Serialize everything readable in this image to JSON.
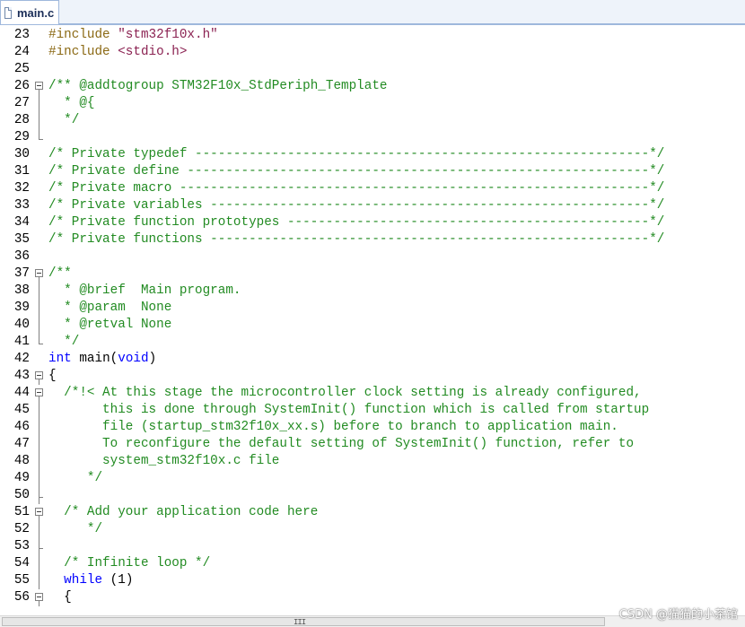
{
  "tab": {
    "label": "main.c",
    "icon": "file-icon"
  },
  "colors": {
    "comment": "#228b22",
    "preprocessor": "#8b6914",
    "string": "#8b2252",
    "keyword": "#0000ff",
    "text": "#000000"
  },
  "lines": [
    {
      "n": "23",
      "fold": "",
      "tokens": [
        {
          "t": "#include ",
          "c": "pp"
        },
        {
          "t": "\"stm32f10x.h\"",
          "c": "str"
        }
      ]
    },
    {
      "n": "24",
      "fold": "",
      "tokens": [
        {
          "t": "#include ",
          "c": "pp"
        },
        {
          "t": "<stdio.h>",
          "c": "str"
        }
      ]
    },
    {
      "n": "25",
      "fold": "",
      "tokens": []
    },
    {
      "n": "26",
      "fold": "box",
      "tokens": [
        {
          "t": "/** @addtogroup STM32F10x_StdPeriph_Template",
          "c": "comment"
        }
      ]
    },
    {
      "n": "27",
      "fold": "line",
      "tokens": [
        {
          "t": "  * @{",
          "c": "comment"
        }
      ]
    },
    {
      "n": "28",
      "fold": "line",
      "tokens": [
        {
          "t": "  */",
          "c": "comment"
        }
      ]
    },
    {
      "n": "29",
      "fold": "end",
      "tokens": []
    },
    {
      "n": "30",
      "fold": "",
      "tokens": [
        {
          "t": "/* Private typedef -----------------------------------------------------------*/",
          "c": "comment"
        }
      ]
    },
    {
      "n": "31",
      "fold": "",
      "tokens": [
        {
          "t": "/* Private define ------------------------------------------------------------*/",
          "c": "comment"
        }
      ]
    },
    {
      "n": "32",
      "fold": "",
      "tokens": [
        {
          "t": "/* Private macro -------------------------------------------------------------*/",
          "c": "comment"
        }
      ]
    },
    {
      "n": "33",
      "fold": "",
      "tokens": [
        {
          "t": "/* Private variables ---------------------------------------------------------*/",
          "c": "comment"
        }
      ]
    },
    {
      "n": "34",
      "fold": "",
      "tokens": [
        {
          "t": "/* Private function prototypes -----------------------------------------------*/",
          "c": "comment"
        }
      ]
    },
    {
      "n": "35",
      "fold": "",
      "tokens": [
        {
          "t": "/* Private functions ---------------------------------------------------------*/",
          "c": "comment"
        }
      ]
    },
    {
      "n": "36",
      "fold": "",
      "tokens": []
    },
    {
      "n": "37",
      "fold": "box",
      "tokens": [
        {
          "t": "/**",
          "c": "comment"
        }
      ]
    },
    {
      "n": "38",
      "fold": "line",
      "tokens": [
        {
          "t": "  * @brief  Main program.",
          "c": "comment"
        }
      ]
    },
    {
      "n": "39",
      "fold": "line",
      "tokens": [
        {
          "t": "  * @param  None",
          "c": "comment"
        }
      ]
    },
    {
      "n": "40",
      "fold": "line",
      "tokens": [
        {
          "t": "  * @retval None",
          "c": "comment"
        }
      ]
    },
    {
      "n": "41",
      "fold": "end",
      "tokens": [
        {
          "t": "  */",
          "c": "comment"
        }
      ]
    },
    {
      "n": "42",
      "fold": "",
      "tokens": [
        {
          "t": "int",
          "c": "kw"
        },
        {
          "t": " main(",
          "c": "plain"
        },
        {
          "t": "void",
          "c": "kw"
        },
        {
          "t": ")",
          "c": "plain"
        }
      ]
    },
    {
      "n": "43",
      "fold": "box",
      "tokens": [
        {
          "t": "{",
          "c": "plain"
        }
      ]
    },
    {
      "n": "44",
      "fold": "box",
      "tokens": [
        {
          "t": "  /*!< At this stage the microcontroller clock setting is already configured,",
          "c": "comment"
        }
      ]
    },
    {
      "n": "45",
      "fold": "line",
      "tokens": [
        {
          "t": "       this is done through SystemInit() function which is called from startup",
          "c": "comment"
        }
      ]
    },
    {
      "n": "46",
      "fold": "line",
      "tokens": [
        {
          "t": "       file (startup_stm32f10x_xx.s) before to branch to application main.",
          "c": "comment"
        }
      ]
    },
    {
      "n": "47",
      "fold": "line",
      "tokens": [
        {
          "t": "       To reconfigure the default setting of SystemInit() function, refer to",
          "c": "comment"
        }
      ]
    },
    {
      "n": "48",
      "fold": "line",
      "tokens": [
        {
          "t": "       system_stm32f10x.c file",
          "c": "comment"
        }
      ]
    },
    {
      "n": "49",
      "fold": "line",
      "tokens": [
        {
          "t": "     */",
          "c": "comment"
        }
      ]
    },
    {
      "n": "50",
      "fold": "mid",
      "tokens": []
    },
    {
      "n": "51",
      "fold": "box",
      "tokens": [
        {
          "t": "  /* Add your application code here",
          "c": "comment"
        }
      ]
    },
    {
      "n": "52",
      "fold": "line",
      "tokens": [
        {
          "t": "     */",
          "c": "comment"
        }
      ]
    },
    {
      "n": "53",
      "fold": "mid",
      "tokens": []
    },
    {
      "n": "54",
      "fold": "line",
      "tokens": [
        {
          "t": "  /* Infinite loop */",
          "c": "comment"
        }
      ]
    },
    {
      "n": "55",
      "fold": "line",
      "tokens": [
        {
          "t": "  ",
          "c": "plain"
        },
        {
          "t": "while",
          "c": "kw"
        },
        {
          "t": " (1)",
          "c": "plain"
        }
      ]
    },
    {
      "n": "56",
      "fold": "box",
      "tokens": [
        {
          "t": "  {",
          "c": "plain"
        }
      ]
    }
  ],
  "scrollbar": {
    "grip": "III"
  },
  "watermark": "CSDN @猫猫的小茶馆"
}
